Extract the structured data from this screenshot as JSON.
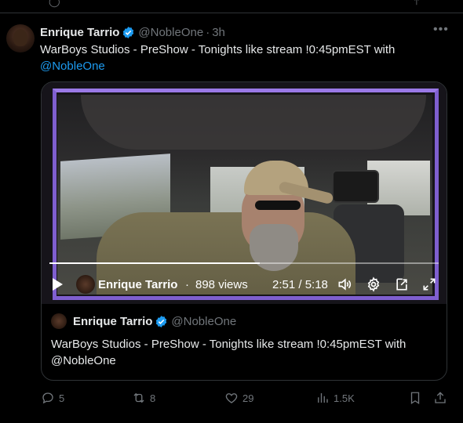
{
  "tweet": {
    "author_name": "Enrique Tarrio",
    "handle": "@NobleOne",
    "separator": "·",
    "time": "3h",
    "text_main": "WarBoys Studios - PreShow - Tonights like stream !0:45pmEST with",
    "mention": "@NobleOne"
  },
  "video": {
    "author_name": "Enrique Tarrio",
    "separator": "·",
    "views": "898 views",
    "time_display": "2:51 / 5:18",
    "progress": 0.54
  },
  "quote": {
    "author_name": "Enrique Tarrio",
    "handle": "@NobleOne",
    "text": "WarBoys Studios - PreShow - Tonights like stream !0:45pmEST with @NobleOne"
  },
  "actions": {
    "replies": "5",
    "reposts": "8",
    "likes": "29",
    "views": "1.5K"
  },
  "colors": {
    "accent": "#1d9bf0",
    "muted": "#71767b",
    "border": "#2f3336",
    "video_frame": "#7f5fcf"
  }
}
